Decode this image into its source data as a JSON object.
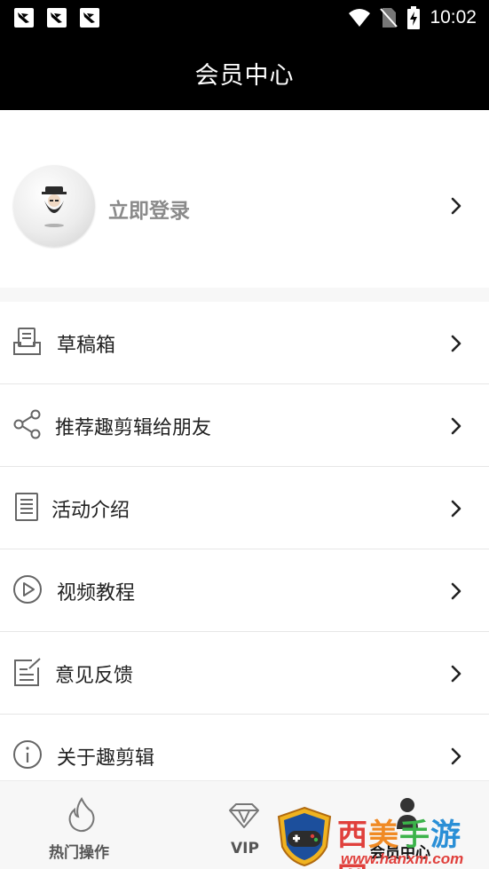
{
  "status_bar": {
    "time": "10:02",
    "notification_icons": [
      "notification-icon",
      "notification-icon",
      "notification-icon"
    ],
    "system_icons": [
      "wifi-icon",
      "no-sim-icon",
      "battery-charging-icon"
    ]
  },
  "header": {
    "title": "会员中心"
  },
  "profile": {
    "login_label": "立即登录",
    "avatar_icon": "avatar-icon"
  },
  "menu": {
    "items": [
      {
        "label": "草稿箱",
        "icon": "draft-box-icon"
      },
      {
        "label": "推荐趣剪辑给朋友",
        "icon": "share-icon"
      },
      {
        "label": "活动介绍",
        "icon": "document-icon"
      },
      {
        "label": "视频教程",
        "icon": "play-circle-icon"
      },
      {
        "label": "意见反馈",
        "icon": "feedback-edit-icon"
      },
      {
        "label": "关于趣剪辑",
        "icon": "info-icon"
      }
    ]
  },
  "tabbar": {
    "tabs": [
      {
        "label": "热门操作",
        "icon": "flame-icon"
      },
      {
        "label": "VIP",
        "icon": "diamond-icon"
      },
      {
        "label": "会员中心",
        "icon": "person-icon"
      }
    ]
  },
  "watermark": {
    "brand": "西美手游网",
    "url": "www.hanxm.com"
  },
  "colors": {
    "header_bg": "#000000",
    "page_bg": "#f7f7f7",
    "login_text": "#8a8a8a",
    "watermark_red": "#e0403c"
  }
}
